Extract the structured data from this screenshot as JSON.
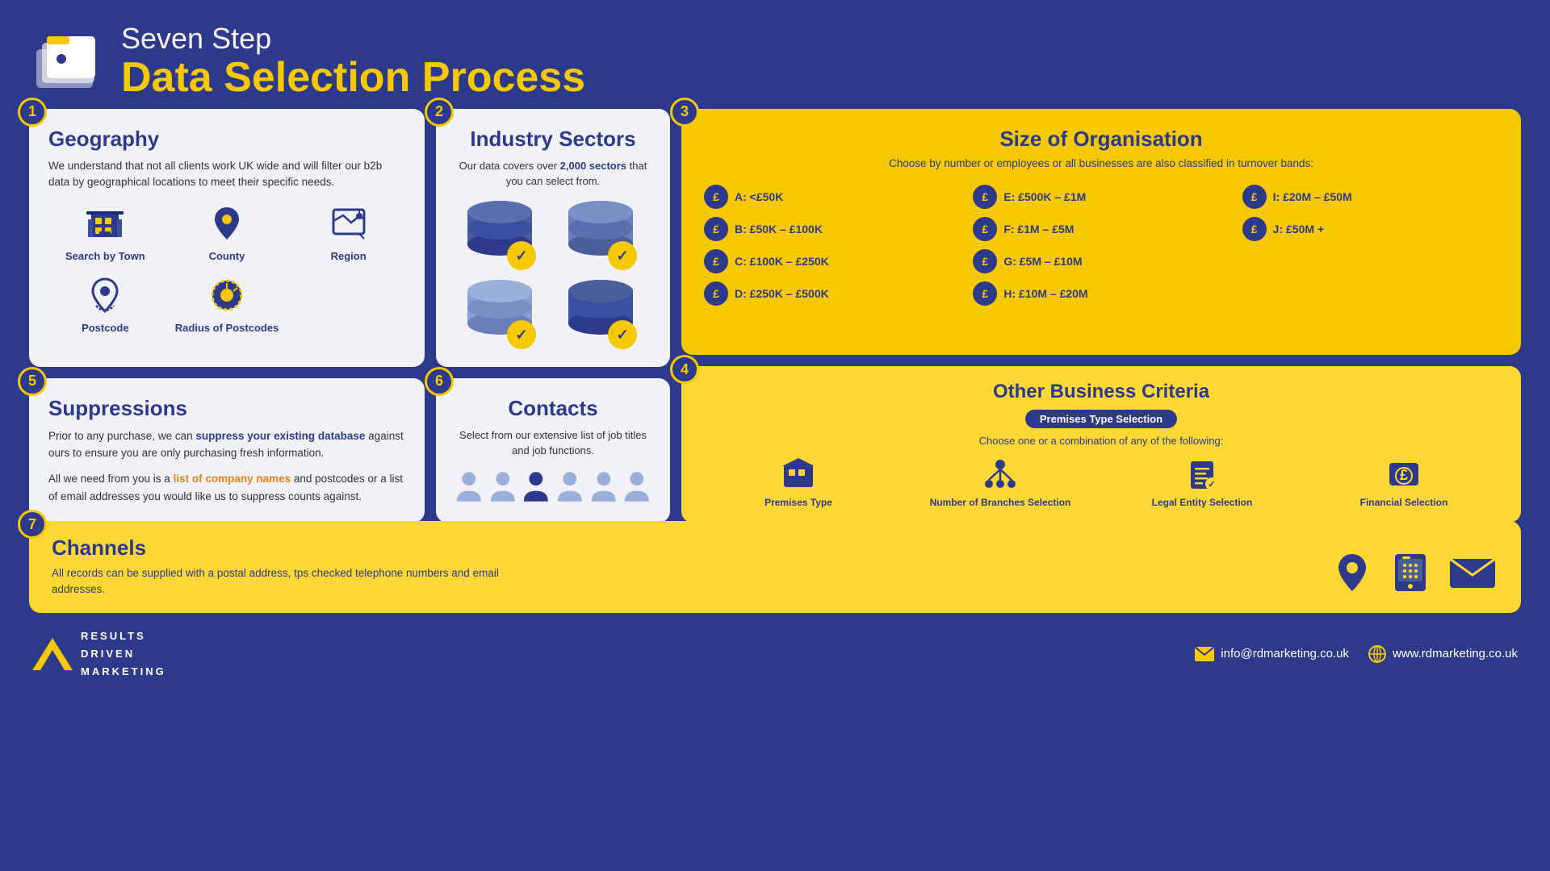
{
  "header": {
    "subtitle": "Seven Step",
    "title": "Data Selection Process"
  },
  "steps": {
    "step1": {
      "number": "1",
      "title": "Geography",
      "description": "We understand that not all clients work UK wide and will filter our b2b data by geographical locations to meet their specific needs.",
      "geo_items": [
        {
          "label": "Search by Town",
          "icon": "building"
        },
        {
          "label": "County",
          "icon": "pin"
        },
        {
          "label": "Region",
          "icon": "map"
        },
        {
          "label": "Postcode",
          "icon": "postcode"
        },
        {
          "label": "Radius of Postcodes",
          "icon": "radius"
        }
      ]
    },
    "step2": {
      "number": "2",
      "title": "Industry Sectors",
      "description_part1": "Our data covers over ",
      "description_highlight": "2,000 sectors",
      "description_part2": " that you can select from."
    },
    "step3": {
      "number": "3",
      "title": "Size of Organisation",
      "subtitle": "Choose by number or employees or all businesses are also classified in turnover bands:",
      "turnover_items": [
        {
          "label": "A: <£50K"
        },
        {
          "label": "E: £500K – £1M"
        },
        {
          "label": "I: £20M – £50M"
        },
        {
          "label": "B: £50K – £100K"
        },
        {
          "label": "F: £1M – £5M"
        },
        {
          "label": "J: £50M +"
        },
        {
          "label": "C: £100K – £250K"
        },
        {
          "label": "G: £5M – £10M"
        },
        {
          "label": ""
        },
        {
          "label": "D: £250K – £500K"
        },
        {
          "label": "H: £10M – £20M"
        },
        {
          "label": ""
        }
      ]
    },
    "step4": {
      "number": "4",
      "title": "Other Business Criteria",
      "badge": "Premises Type Selection",
      "description": "Choose one or a combination of any of the following:",
      "criteria": [
        {
          "label": "Premises Type"
        },
        {
          "label": "Number of Branches Selection"
        },
        {
          "label": "Legal Entity Selection"
        },
        {
          "label": "Financial Selection"
        }
      ]
    },
    "step5": {
      "number": "5",
      "title": "Suppressions",
      "para1_normal1": "Prior to any purchase, we can ",
      "para1_highlight": "suppress your existing database",
      "para1_normal2": " against ours to ensure you are only purchasing fresh information.",
      "para2_normal1": "All we need from you is a ",
      "para2_highlight": "list of company names",
      "para2_normal2": " and postcodes or a list of email addresses you would like us to suppress counts against."
    },
    "step6": {
      "number": "6",
      "title": "Contacts",
      "description": "Select from our extensive list of job titles and job functions.",
      "person_count": 6
    },
    "step7": {
      "number": "7",
      "title": "Channels",
      "description": "All records can be supplied with a postal address, tps checked telephone numbers and email addresses."
    }
  },
  "footer": {
    "logo_lines": [
      "RESULTS",
      "DRIVEN",
      "MARKETING"
    ],
    "email": "info@rdmarketing.co.uk",
    "website": "www.rdmarketing.co.uk"
  }
}
